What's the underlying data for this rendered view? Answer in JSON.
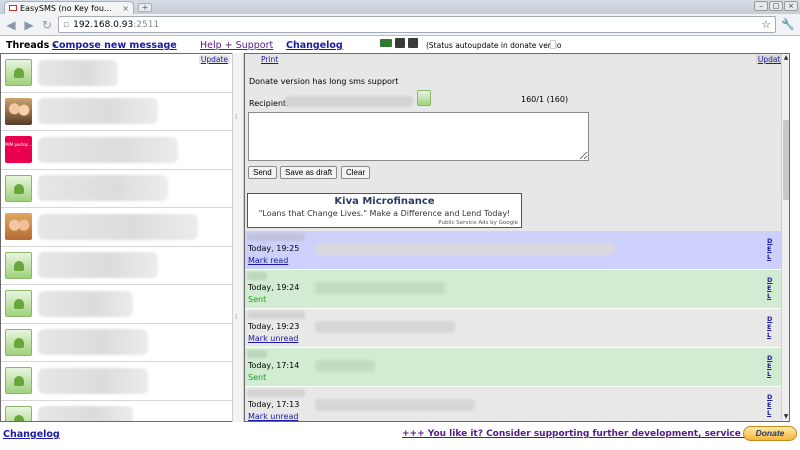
{
  "browser": {
    "tab_title": "EasySMS (no Key fou...",
    "tab_close": "×",
    "new_tab": "+",
    "url_host": "192.168.0.93",
    "url_port": ":2511"
  },
  "header": {
    "threads_label": "Threads -",
    "compose_label": "Compose new message",
    "help_label": "Help + Support",
    "changelog_label": "Changelog",
    "status_text": "(Status autoupdate in donate versio"
  },
  "threads": {
    "update_label": "Update",
    "items": [
      {
        "avatar": "android"
      },
      {
        "avatar": "photo1"
      },
      {
        "avatar": "photo2",
        "avatar_text": "MIM postop .. .."
      },
      {
        "avatar": "android"
      },
      {
        "avatar": "photo3"
      },
      {
        "avatar": "android"
      },
      {
        "avatar": "android"
      },
      {
        "avatar": "android"
      },
      {
        "avatar": "android"
      },
      {
        "avatar": "android"
      }
    ]
  },
  "composer": {
    "print_label": "Print",
    "update_label": "Update",
    "long_sms_notice": "Donate version has long sms support",
    "recipient_label": "Recipient:",
    "counter": "160/1 (160)",
    "message_value": "",
    "send_label": "Send",
    "draft_label": "Save as draft",
    "clear_label": "Clear"
  },
  "ad": {
    "title": "Kiva Microfinance",
    "tagline": "\"Loans that Change Lives.\" Make a Difference and Lend Today!",
    "footer": "Public Service Ads by Google"
  },
  "messages": [
    {
      "color": "blue",
      "time": "Today, 19:25",
      "status": "Mark read",
      "status_type": "link",
      "body_width": 300,
      "actions": "D E L"
    },
    {
      "color": "green",
      "time": "Today, 19:24",
      "status": "Sent",
      "status_type": "sent",
      "body_width": 130,
      "actions": "D E L"
    },
    {
      "color": "grey",
      "time": "Today, 19:23",
      "status": "Mark unread",
      "status_type": "link",
      "body_width": 140,
      "actions": "D E L"
    },
    {
      "color": "green",
      "time": "Today, 17:14",
      "status": "Sent",
      "status_type": "sent",
      "body_width": 60,
      "actions": "D E L"
    },
    {
      "color": "grey",
      "time": "Today, 17:13",
      "status": "Mark unread",
      "status_type": "link",
      "body_width": 160,
      "actions": "D E L"
    }
  ],
  "footer": {
    "changelog_label": "Changelog",
    "support_label": "+++ You like it? Consider supporting further development, service + support",
    "donate_label": "Donate"
  },
  "colors": {
    "unread_bg": "#ccd0fb",
    "sent_bg": "#d1ecd3",
    "read_bg": "#e8e8e8",
    "link": "#1a1aa6"
  },
  "icons": [
    "back-icon",
    "forward-icon",
    "reload-icon",
    "star-icon",
    "wrench-icon",
    "battery-icon",
    "signal-icon"
  ]
}
